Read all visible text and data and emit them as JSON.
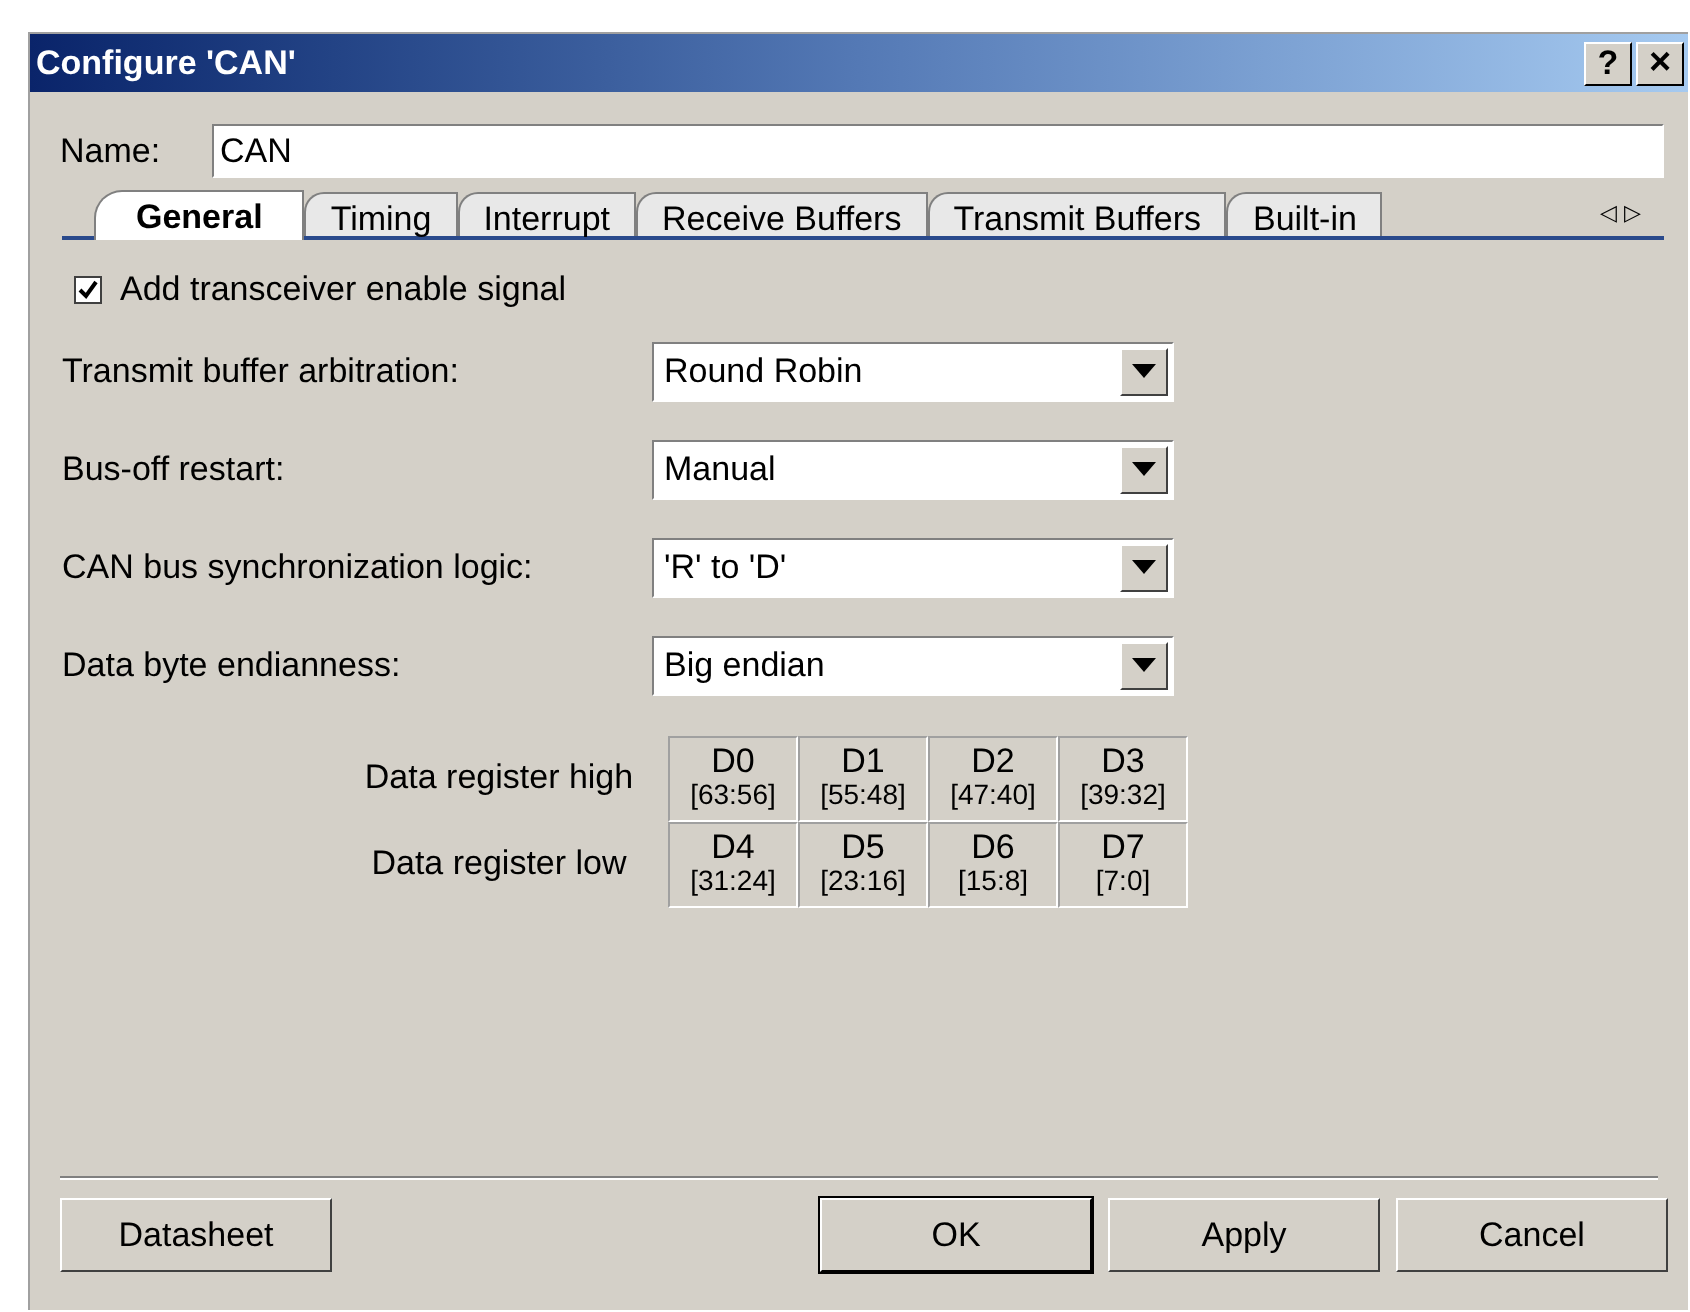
{
  "window": {
    "title": "Configure 'CAN'",
    "help_button": "?",
    "close_button": "×"
  },
  "name_field": {
    "label": "Name:",
    "value": "CAN"
  },
  "tabs": [
    {
      "label": "General",
      "selected": true
    },
    {
      "label": "Timing",
      "selected": false
    },
    {
      "label": "Interrupt",
      "selected": false
    },
    {
      "label": "Receive Buffers",
      "selected": false
    },
    {
      "label": "Transmit Buffers",
      "selected": false
    },
    {
      "label": "Built-in",
      "selected": false
    }
  ],
  "tab_scroll": {
    "left": "◁",
    "right": "▷"
  },
  "transceiver_checkbox": {
    "label": "Add transceiver enable signal",
    "checked": true
  },
  "settings": [
    {
      "label": "Transmit buffer arbitration:",
      "value": "Round Robin"
    },
    {
      "label": "Bus-off restart:",
      "value": "Manual"
    },
    {
      "label": "CAN bus synchronization logic:",
      "value": "'R' to 'D'"
    },
    {
      "label": "Data byte endianness:",
      "value": "Big endian"
    }
  ],
  "data_registers": [
    {
      "label": "Data register high",
      "bytes": [
        {
          "name": "D0",
          "bits": "[63:56]"
        },
        {
          "name": "D1",
          "bits": "[55:48]"
        },
        {
          "name": "D2",
          "bits": "[47:40]"
        },
        {
          "name": "D3",
          "bits": "[39:32]"
        }
      ]
    },
    {
      "label": "Data register low",
      "bytes": [
        {
          "name": "D4",
          "bits": "[31:24]"
        },
        {
          "name": "D5",
          "bits": "[23:16]"
        },
        {
          "name": "D6",
          "bits": "[15:8]"
        },
        {
          "name": "D7",
          "bits": "[7:0]"
        }
      ]
    }
  ],
  "buttons": [
    {
      "label": "Datasheet",
      "kind": "left",
      "default": false
    },
    {
      "label": "OK",
      "kind": "right",
      "default": true
    },
    {
      "label": "Apply",
      "kind": "right",
      "default": false
    },
    {
      "label": "Cancel",
      "kind": "right",
      "default": false
    }
  ]
}
